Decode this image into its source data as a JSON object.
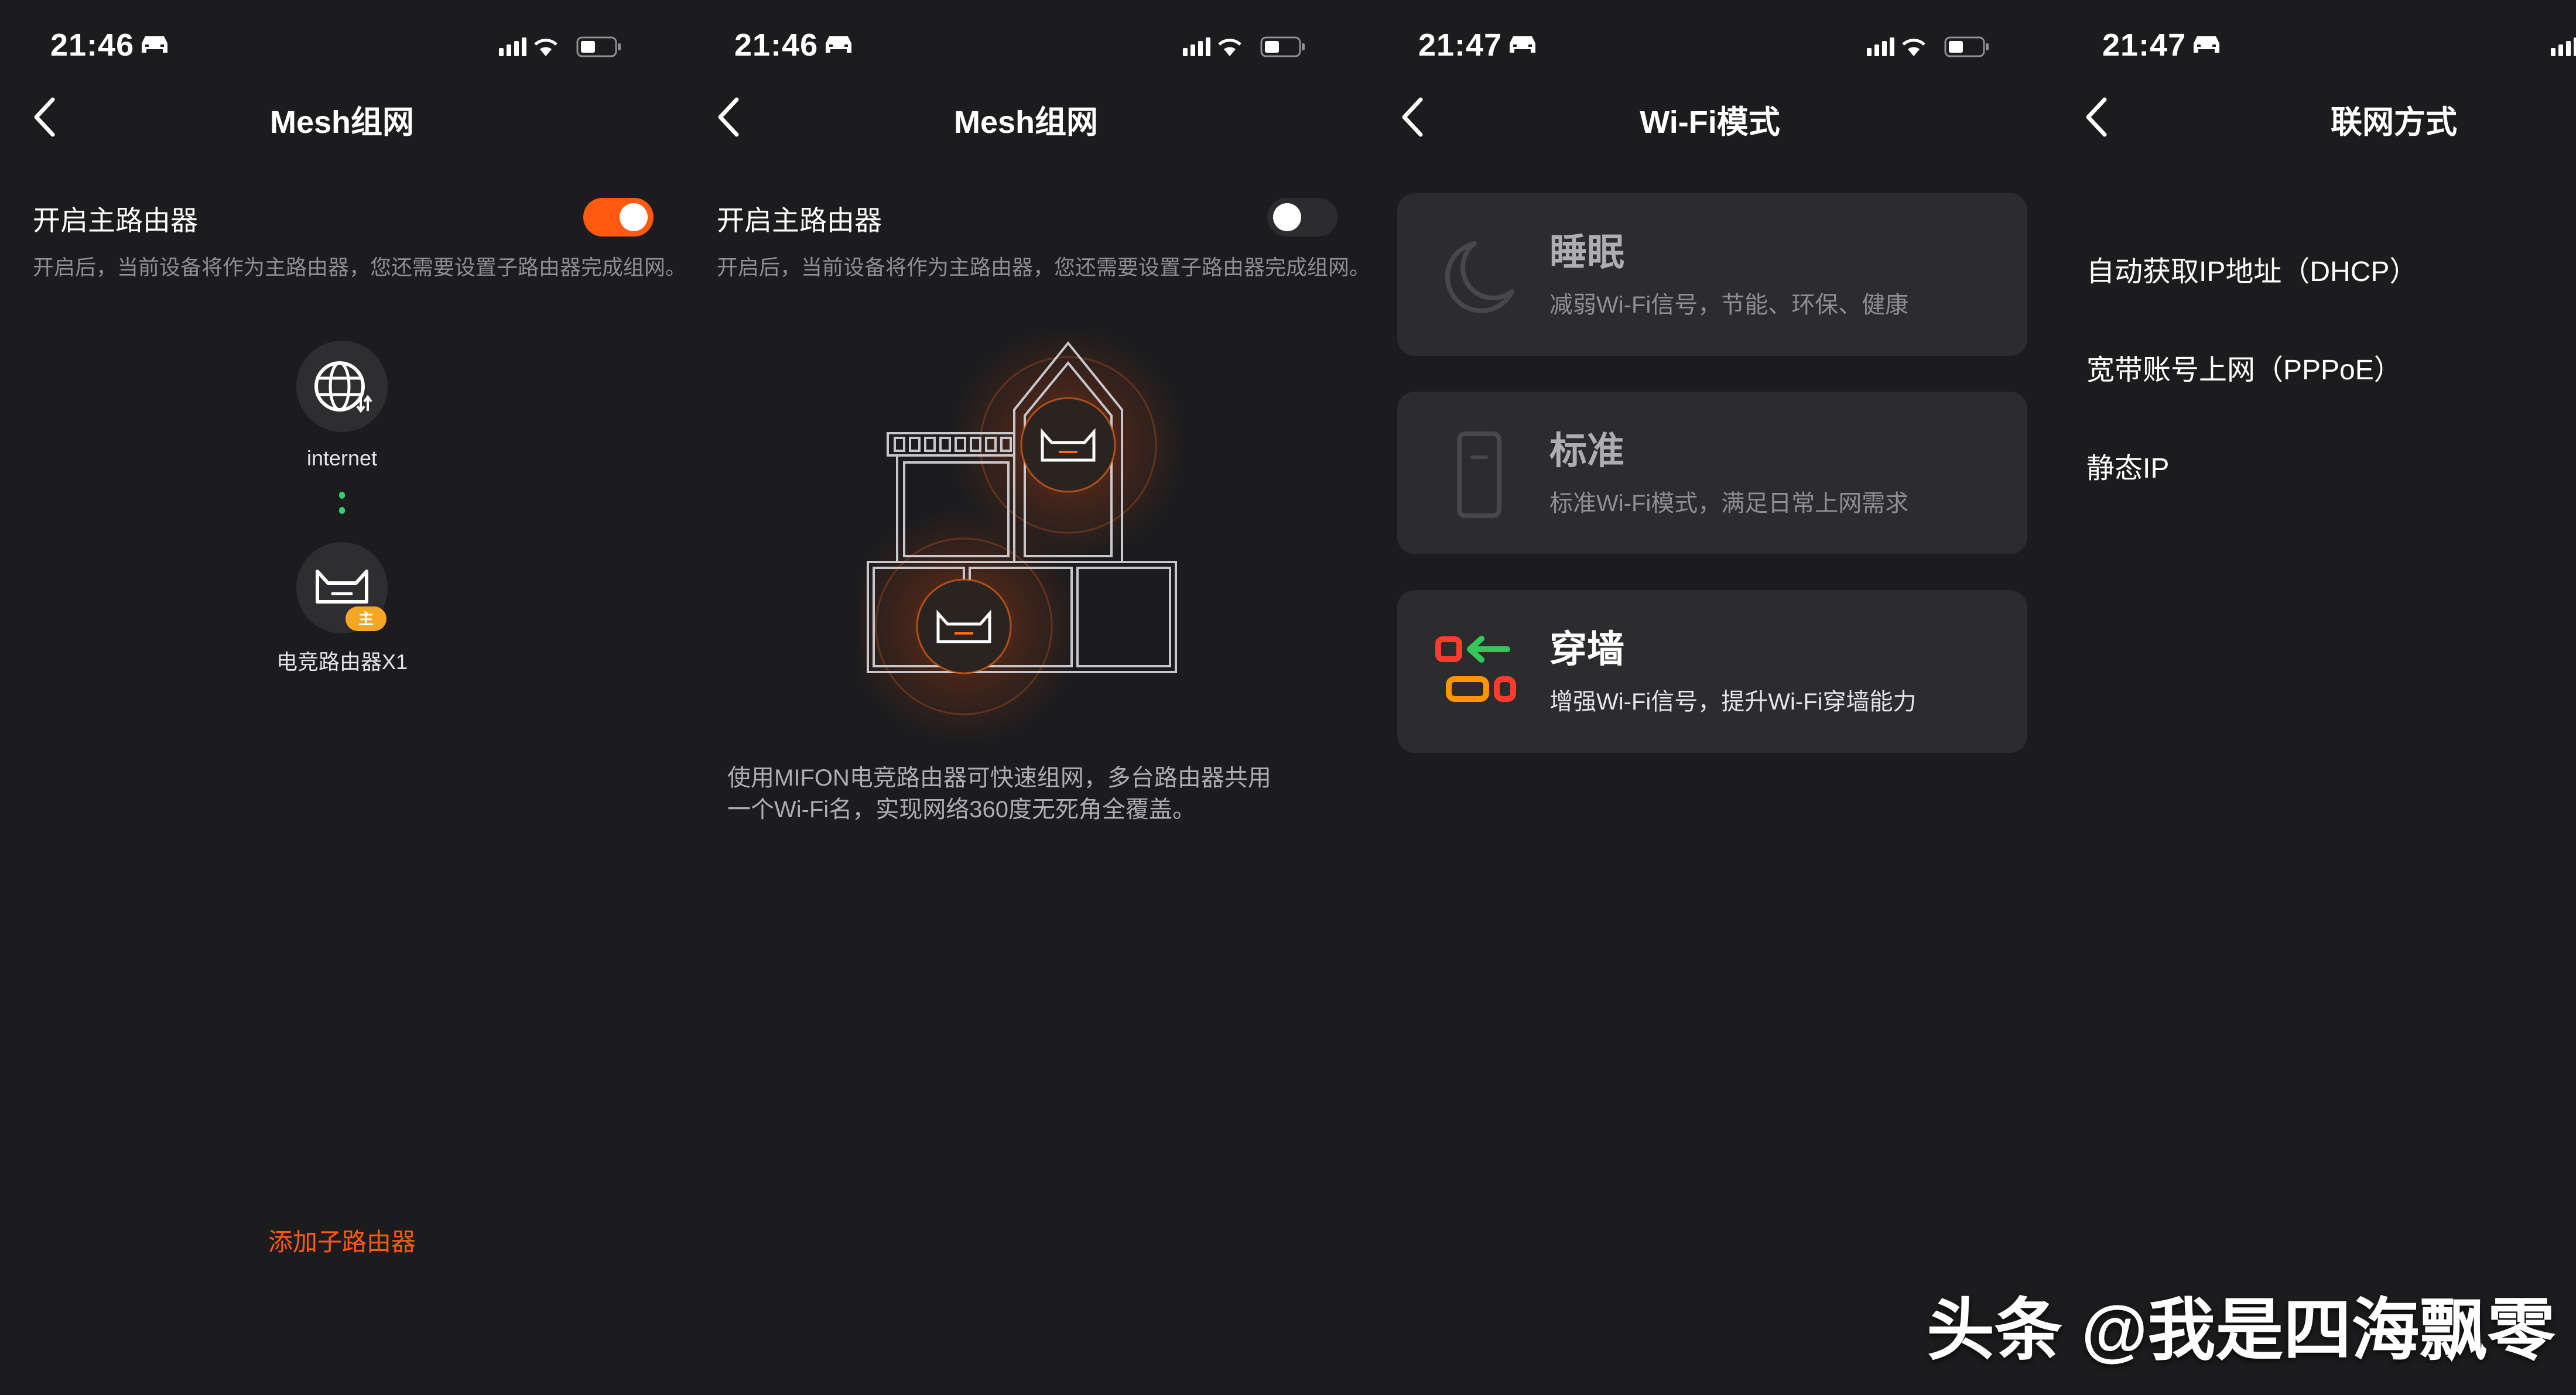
{
  "screens": [
    {
      "time": "21:46",
      "title": "Mesh组网",
      "toggle_label": "开启主路由器",
      "toggle_state": "on",
      "toggle_desc": "开启后，当前设备将作为主路由器，您还需要设置子路由器完成组网。",
      "internet_label": "internet",
      "router_label": "电竞路由器X1",
      "router_badge": "主",
      "add_button": "添加子路由器"
    },
    {
      "time": "21:46",
      "title": "Mesh组网",
      "toggle_label": "开启主路由器",
      "toggle_state": "off",
      "toggle_desc": "开启后，当前设备将作为主路由器，您还需要设置子路由器完成组网。",
      "desc_line1": "使用MIFON电竞路由器可快速组网，多台路由器共用",
      "desc_line2": "一个Wi-Fi名，实现网络360度无死角全覆盖。"
    },
    {
      "time": "21:47",
      "title": "Wi-Fi模式",
      "modes": [
        {
          "name": "睡眠",
          "desc": "减弱Wi-Fi信号，节能、环保、健康",
          "icon": "moon-icon",
          "selected": false
        },
        {
          "name": "标准",
          "desc": "标准Wi-Fi模式，满足日常上网需求",
          "icon": "phone-icon",
          "selected": false
        },
        {
          "name": "穿墙",
          "desc": "增强Wi-Fi信号，提升Wi-Fi穿墙能力",
          "icon": "wall-penetration-icon",
          "selected": true
        }
      ]
    },
    {
      "time": "21:47",
      "title": "联网方式",
      "options": [
        "自动获取IP地址（DHCP）",
        "宽带账号上网（PPPoE）",
        "静态IP"
      ]
    }
  ],
  "watermark": "头条 @我是四海飘零",
  "colors": {
    "accent": "#ff5a10",
    "background": "#1c1c1e",
    "card": "#2c2c2e",
    "link_dot": "#2fd36b",
    "badge": "#f5a623"
  }
}
